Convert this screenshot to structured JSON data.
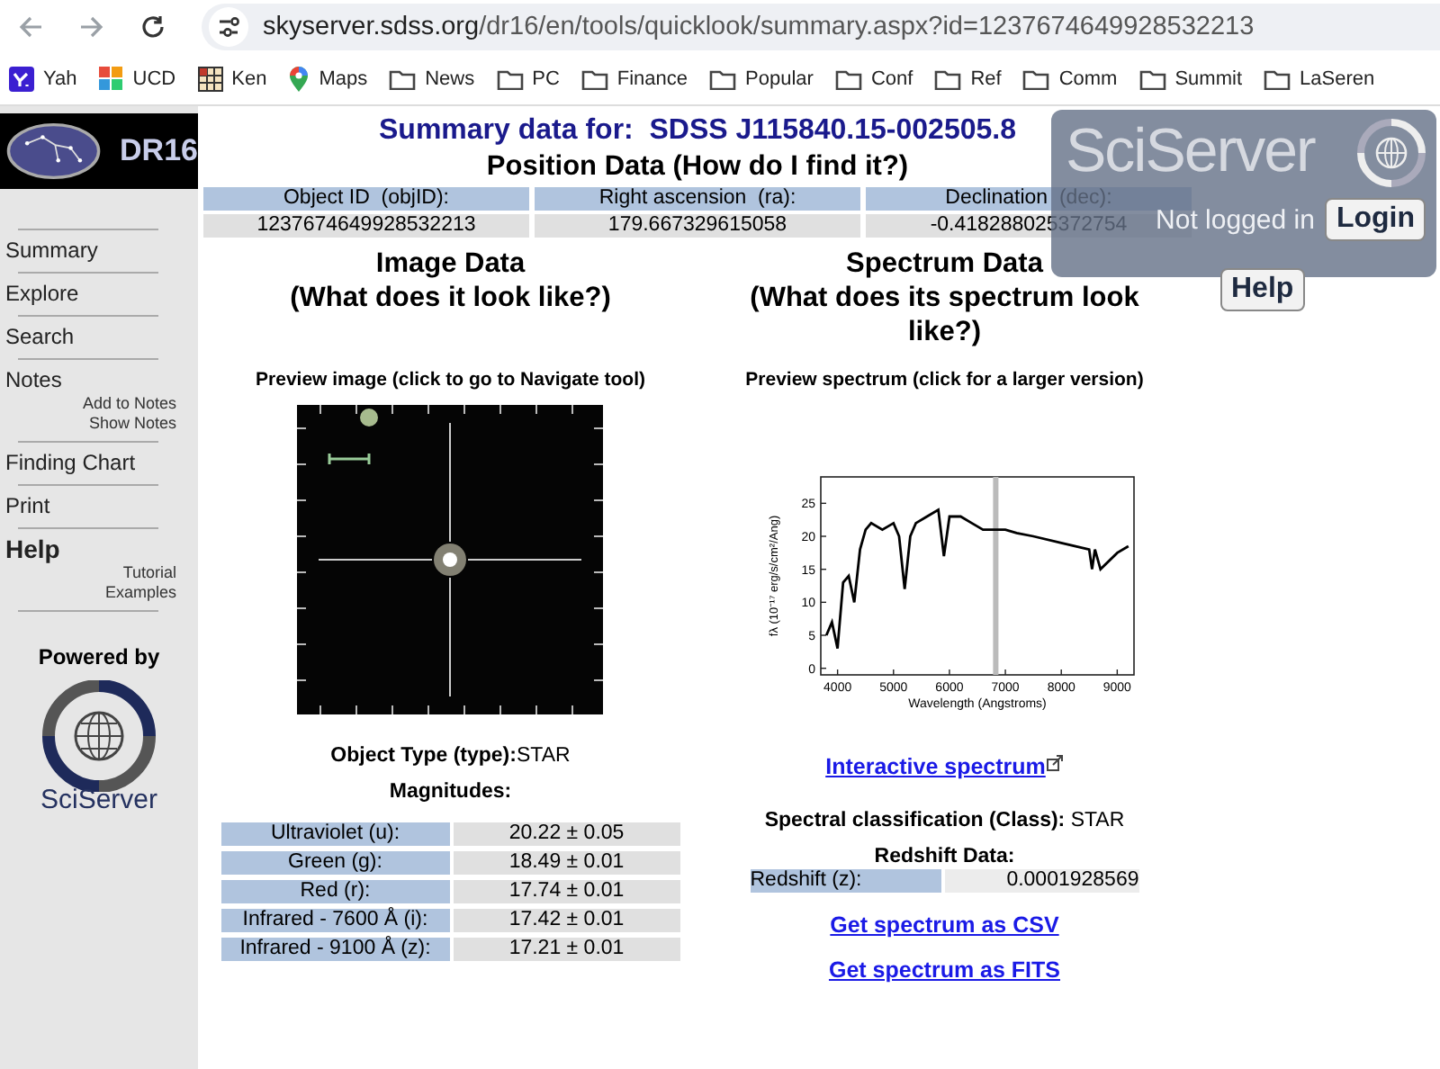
{
  "browser": {
    "url": {
      "host": "skyserver.sdss.org",
      "path": "/dr16/en/tools/quicklook/summary.aspx?id=1237674649928532213"
    },
    "bookmarks": [
      {
        "label": "Yah",
        "kind": "yahoo"
      },
      {
        "label": "UCD",
        "kind": "tiles"
      },
      {
        "label": "Ken",
        "kind": "grid"
      },
      {
        "label": "Maps",
        "kind": "pin"
      },
      {
        "label": "News",
        "kind": "folder"
      },
      {
        "label": "PC",
        "kind": "folder"
      },
      {
        "label": "Finance",
        "kind": "folder"
      },
      {
        "label": "Popular",
        "kind": "folder"
      },
      {
        "label": "Conf",
        "kind": "folder"
      },
      {
        "label": "Ref",
        "kind": "folder"
      },
      {
        "label": "Comm",
        "kind": "folder"
      },
      {
        "label": "Summit",
        "kind": "folder"
      },
      {
        "label": "LaSeren",
        "kind": "folder"
      }
    ]
  },
  "sidebar": {
    "logo": "DR16",
    "items": [
      {
        "label": "Summary",
        "kind": "link"
      },
      {
        "label": "Explore",
        "kind": "link"
      },
      {
        "label": "Search",
        "kind": "link"
      },
      {
        "label": "Notes",
        "kind": "link",
        "children": [
          {
            "label": "Add to Notes"
          },
          {
            "label": "Show Notes"
          }
        ]
      },
      {
        "label": "Finding Chart",
        "kind": "link"
      },
      {
        "label": "Print",
        "kind": "link"
      },
      {
        "label": "Help",
        "kind": "heading",
        "children": [
          {
            "label": "Tutorial"
          },
          {
            "label": "Examples"
          }
        ]
      }
    ],
    "powered_by": "Powered by",
    "powered_logo": "SciServer"
  },
  "sciserver": {
    "brand": "SciServer",
    "status": "Not logged in",
    "login": "Login",
    "help": "Help"
  },
  "title": "Summary data for:  SDSS J115840.15-002505.8",
  "position": {
    "heading": "Position Data (How do I find it?)",
    "columns": [
      "Object ID  (objID):",
      "Right ascension  (ra):",
      "Declination  (dec):"
    ],
    "values": [
      "1237674649928532213",
      "179.667329615058",
      "-0.418288025372754"
    ]
  },
  "image": {
    "heading": "Image Data",
    "subheading": "(What does it look like?)",
    "caption": "Preview image (click to go to Navigate tool)",
    "object_type": "**Object Type (type):**STAR",
    "magnitudes_heading": "Magnitudes:",
    "magnitudes": [
      {
        "band": "Ultraviolet (u):",
        "value": "20.22 ± 0.05"
      },
      {
        "band": "Green (g):",
        "value": "18.49 ± 0.01"
      },
      {
        "band": "Red (r):",
        "value": "17.74 ± 0.01"
      },
      {
        "band": "Infrared - 7600 Å (i):",
        "value": "17.42 ± 0.01"
      },
      {
        "band": "Infrared - 9100 Å (z):",
        "value": "17.21 ± 0.01"
      }
    ]
  },
  "spectrum": {
    "heading": "Spectrum Data",
    "subheading": "(What does its spectrum look like?)",
    "caption": "Preview spectrum (click for a larger version)",
    "chart_data": {
      "type": "line",
      "xlabel": "Wavelength (Angstroms)",
      "ylabel": "fλ (10⁻¹⁷ erg/s/cm²/Ang)",
      "xlim": [
        3700,
        9300
      ],
      "ylim": [
        -1,
        29
      ],
      "xticks": [
        4000,
        5000,
        6000,
        7000,
        8000,
        9000
      ],
      "yticks": [
        0,
        5,
        10,
        15,
        20,
        25
      ],
      "x": [
        3800,
        3900,
        4000,
        4100,
        4200,
        4300,
        4400,
        4500,
        4600,
        4800,
        5000,
        5100,
        5200,
        5300,
        5400,
        5600,
        5800,
        5900,
        6000,
        6200,
        6400,
        6600,
        6800,
        7000,
        7200,
        7500,
        8000,
        8500,
        8550,
        8600,
        8700,
        9000,
        9200
      ],
      "series": [
        {
          "color": "#000000",
          "values": [
            5,
            7,
            3,
            13,
            14,
            10,
            18,
            21,
            22,
            21,
            22,
            20,
            12,
            20,
            22,
            23,
            24,
            17,
            23,
            23,
            22,
            21,
            21,
            21,
            20.5,
            20,
            19,
            18,
            15,
            18,
            15,
            17.5,
            18.5
          ]
        }
      ]
    },
    "interactive_link": "Interactive spectrum",
    "classification": "**Spectral classification (Class):** STAR",
    "redshift_heading": "Redshift Data:",
    "redshift_label": "Redshift (z):",
    "redshift_value": "0.0001928569",
    "csv_link": "Get spectrum as CSV",
    "fits_link": "Get spectrum as FITS"
  }
}
